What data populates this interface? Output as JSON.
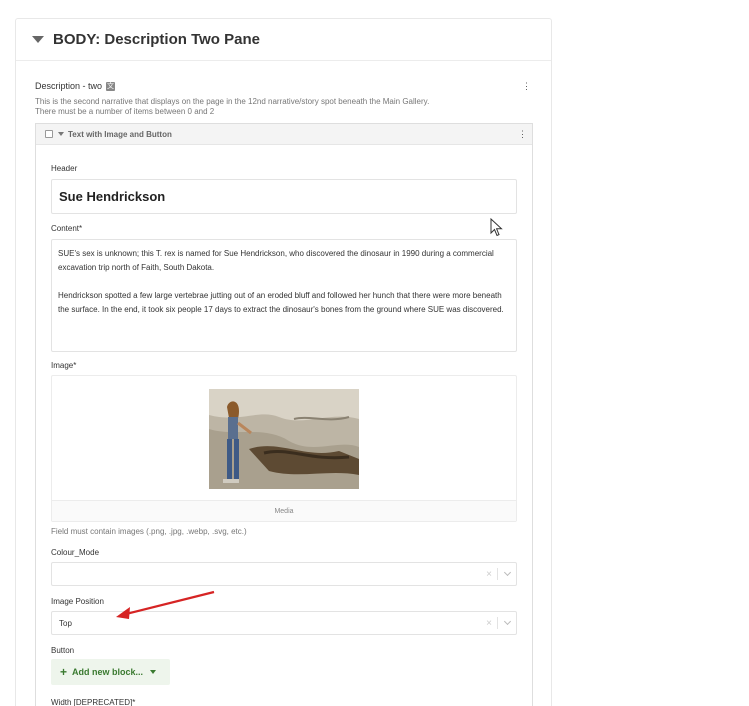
{
  "section": {
    "title": "BODY: Description Two Pane"
  },
  "description_field": {
    "label": "Description - two",
    "translate_glyph": "文",
    "help_line1": "This is the second narrative that displays on the page in the 12nd narrative/story spot beneath the Main Gallery.",
    "help_line2": "There must be a number of items between 0 and 2",
    "menu_glyph": "⋮"
  },
  "block": {
    "title": "Text with Image and Button",
    "menu_glyph": "⋮",
    "header_label": "Header",
    "header_value": "Sue Hendrickson",
    "content_label": "Content*",
    "content_p1": "SUE's sex is unknown; this T. rex is named for Sue Hendrickson, who discovered the dinosaur in 1990 during a commercial excavation trip north of Faith, South Dakota.",
    "content_p2": "Hendrickson spotted a few large vertebrae jutting out of an eroded bluff and followed her hunch that there were more beneath the surface. In the end, it took six people 17 days to extract the dinosaur's bones from the ground where SUE was discovered.",
    "image_label": "Image*",
    "media_label": "Media",
    "image_help": "Field must contain images (.png, .jpg, .webp, .svg, etc.)",
    "colour_mode_label": "Colour_Mode",
    "colour_mode_value": "",
    "image_position_label": "Image Position",
    "image_position_value": "Top",
    "button_label": "Button",
    "add_block_label": "Add new block...",
    "width_label": "Width [DEPRECATED]*",
    "clear_glyph": "×",
    "plus_glyph": "+"
  },
  "colors": {
    "annotation_arrow": "#d62424",
    "add_button_text": "#3a7a30"
  },
  "icons": [
    "caret-down-icon",
    "translate-icon",
    "kebab-menu-icon",
    "checkbox-icon",
    "clear-icon",
    "chevron-down-icon",
    "plus-icon",
    "annotation-arrow-icon",
    "mouse-cursor-icon"
  ]
}
